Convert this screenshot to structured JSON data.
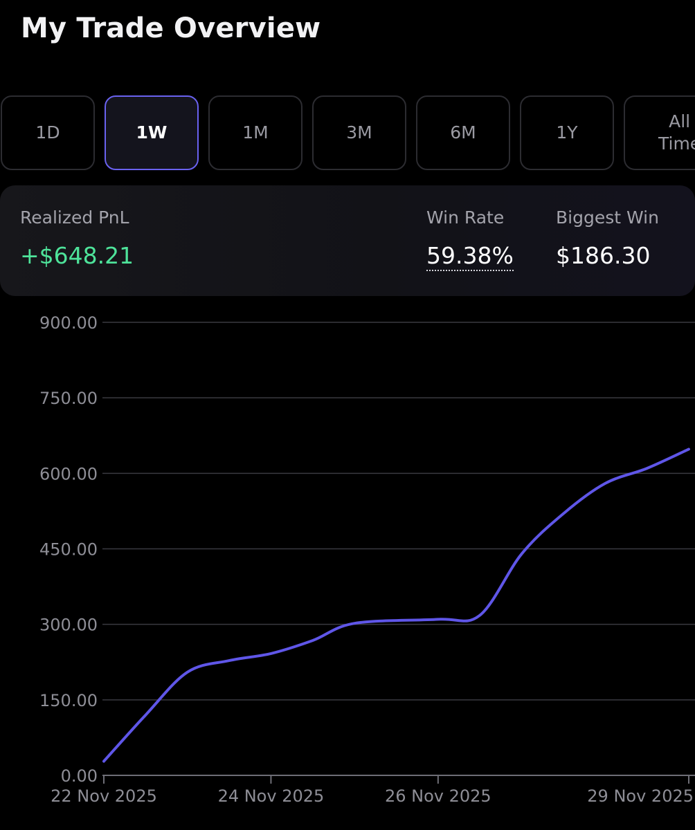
{
  "header": {
    "title": "My Trade Overview"
  },
  "tabs": [
    {
      "label": "1D",
      "active": false
    },
    {
      "label": "1W",
      "active": true
    },
    {
      "label": "1M",
      "active": false
    },
    {
      "label": "3M",
      "active": false
    },
    {
      "label": "6M",
      "active": false
    },
    {
      "label": "1Y",
      "active": false
    },
    {
      "label": "All\nTime",
      "active": false
    }
  ],
  "summary": {
    "realized_pnl": {
      "label": "Realized PnL",
      "value": "+$648.21"
    },
    "win_rate": {
      "label": "Win Rate",
      "value": "59.38%"
    },
    "biggest_win": {
      "label": "Biggest Win",
      "value": "$186.30"
    }
  },
  "colors": {
    "accent": "#5f56e8",
    "positive": "#4ee39a",
    "background": "#000000",
    "grid": "#3a3a40",
    "axis_text": "#8e8e96"
  },
  "chart_data": {
    "type": "line",
    "ylim": [
      0,
      900
    ],
    "y_ticks": [
      "0.00",
      "150.00",
      "300.00",
      "450.00",
      "600.00",
      "750.00",
      "900.00"
    ],
    "x_tick_labels": [
      "22 Nov 2025",
      "24 Nov 2025",
      "26 Nov 2025",
      "29 Nov 2025"
    ],
    "grid": true,
    "series": [
      {
        "color": "#5f56e8",
        "x": [
          "22 Nov 2025",
          "22 Nov 2025",
          "23 Nov 2025",
          "23 Nov 2025",
          "24 Nov 2025",
          "24 Nov 2025",
          "25 Nov 2025",
          "26 Nov 2025",
          "26 Nov 2025",
          "27 Nov 2025",
          "27 Nov 2025",
          "28 Nov 2025",
          "28 Nov 2025",
          "29 Nov 2025"
        ],
        "y": [
          28,
          120,
          205,
          228,
          242,
          268,
          302,
          310,
          318,
          440,
          520,
          580,
          610,
          648
        ]
      }
    ]
  }
}
